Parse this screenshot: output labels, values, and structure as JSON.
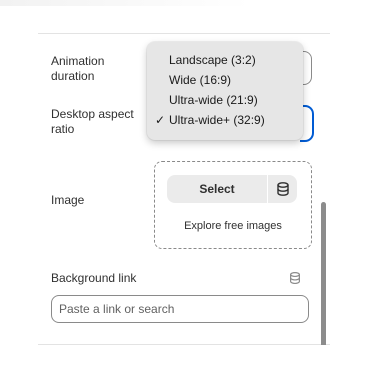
{
  "settings": {
    "animation_duration_label": "Animation duration",
    "desktop_aspect_ratio_label": "Desktop aspect ratio",
    "image_label": "Image",
    "image_select_label": "Select",
    "image_explore_label": "Explore free images",
    "background_link_label": "Background link",
    "background_link_placeholder": "Paste a link or search",
    "background_link_value": ""
  },
  "aspect_dropdown": {
    "options": [
      {
        "label": "Landscape (3:2)",
        "selected": false
      },
      {
        "label": "Wide (16:9)",
        "selected": false
      },
      {
        "label": "Ultra-wide (21:9)",
        "selected": false
      },
      {
        "label": "Ultra-wide+ (32:9)",
        "selected": true
      }
    ],
    "check_mark": "✓"
  },
  "colors": {
    "focus": "#005bd3",
    "text": "#303030",
    "border": "#8a8a8a",
    "button_bg": "#ebebeb",
    "menu_bg": "#e6e6e6"
  },
  "icons": {
    "select_button_icon": "database-icon",
    "background_link_icon": "database-icon"
  }
}
